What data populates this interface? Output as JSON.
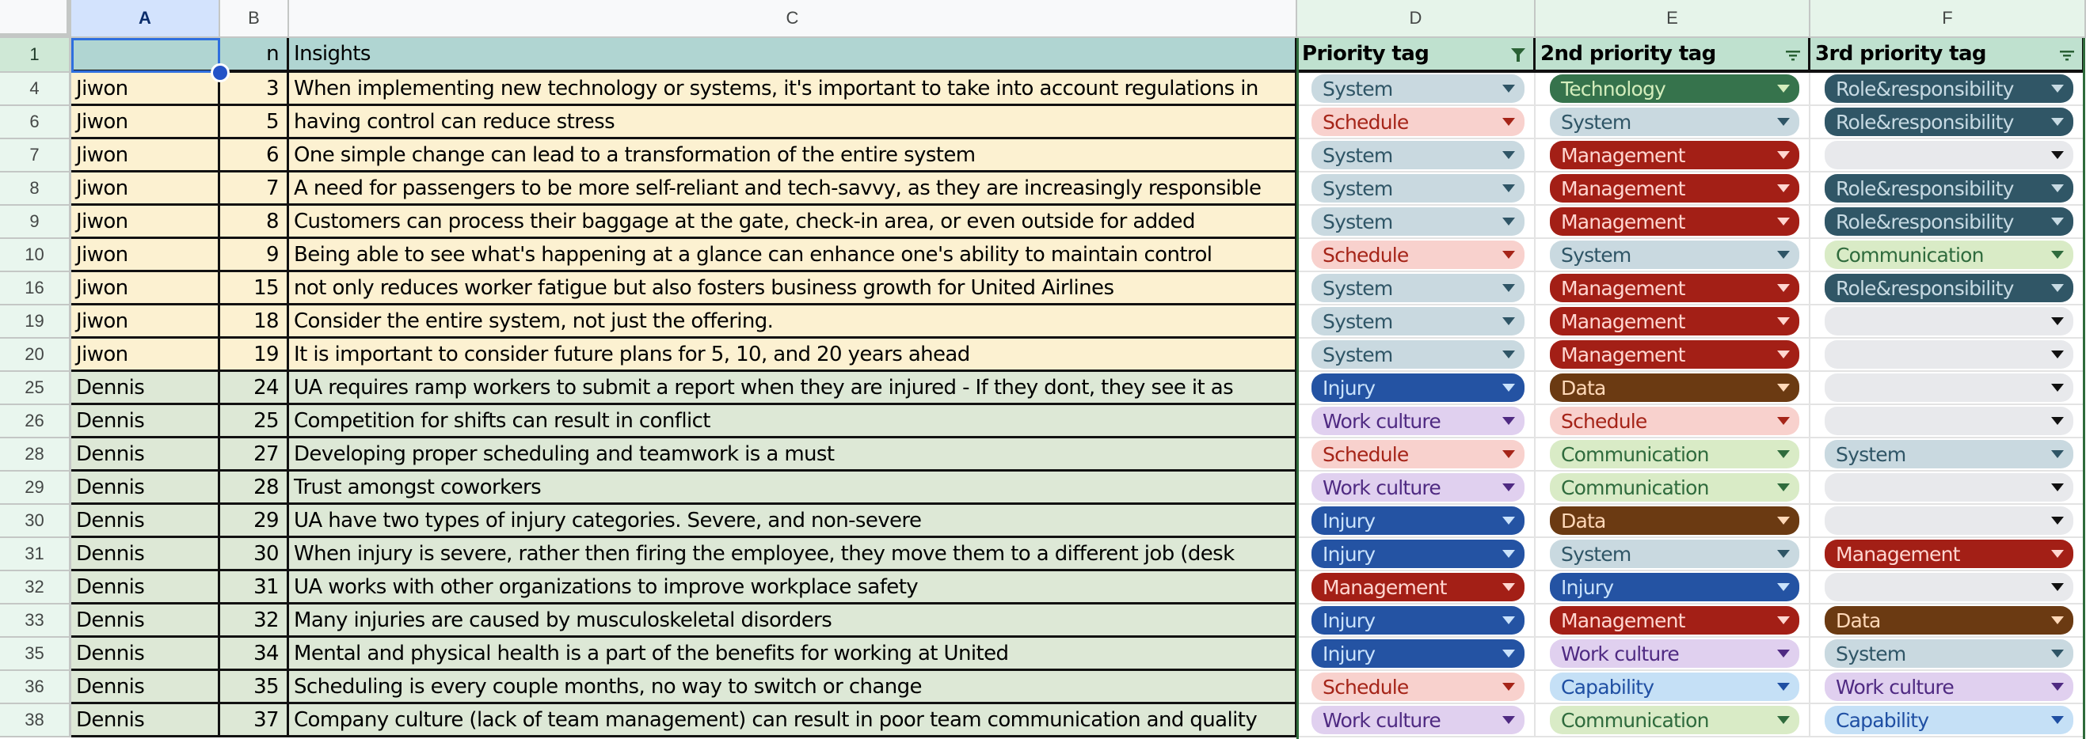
{
  "columns": [
    {
      "letter": "A",
      "selected": true
    },
    {
      "letter": "B"
    },
    {
      "letter": "C"
    },
    {
      "letter": "D"
    },
    {
      "letter": "E"
    },
    {
      "letter": "F"
    }
  ],
  "header_row": {
    "row_number": "1",
    "a": "",
    "b": "n",
    "c": "Insights",
    "d": "Priority tag",
    "e": "2nd priority tag",
    "f": "3rd priority tag",
    "d_filter": "filter-active-icon",
    "e_filter": "filter-icon",
    "f_filter": "filter-icon"
  },
  "tag_styles": {
    "System": {
      "bg": "#c9d9e0",
      "fg": "#2f5566"
    },
    "Schedule": {
      "bg": "#f8d1cd",
      "fg": "#a52418"
    },
    "Technology": {
      "bg": "#36734c",
      "fg": "#d4edbc"
    },
    "Management": {
      "bg": "#a31f16",
      "fg": "#ffd6d0"
    },
    "Role&responsibility": {
      "bg": "#305666",
      "fg": "#c7dae3"
    },
    "Communication": {
      "bg": "#d9ebc6",
      "fg": "#2f6b3d"
    },
    "Injury": {
      "bg": "#2453a3",
      "fg": "#c9e2fb"
    },
    "Data": {
      "bg": "#6b3a12",
      "fg": "#ffd8b8"
    },
    "Work culture": {
      "bg": "#e0d0ef",
      "fg": "#4f2a82"
    },
    "Capability": {
      "bg": "#c5e0f6",
      "fg": "#1f4fa3"
    },
    "": {
      "bg": "#e8e9ec",
      "fg": "#111111"
    }
  },
  "rows": [
    {
      "row": "4",
      "a": "Jiwon",
      "b": "3",
      "c": "When implementing new technology or systems, it's important to take into account regulations in",
      "d": "System",
      "e": "Technology",
      "f": "Role&responsibility"
    },
    {
      "row": "6",
      "a": "Jiwon",
      "b": "5",
      "c": "having control can reduce stress",
      "d": "Schedule",
      "e": "System",
      "f": "Role&responsibility"
    },
    {
      "row": "7",
      "a": "Jiwon",
      "b": "6",
      "c": "One simple change can lead to a transformation of the entire system",
      "d": "System",
      "e": "Management",
      "f": ""
    },
    {
      "row": "8",
      "a": "Jiwon",
      "b": "7",
      "c": "A need for passengers to be more self-reliant and tech-savvy, as they are increasingly responsible",
      "d": "System",
      "e": "Management",
      "f": "Role&responsibility"
    },
    {
      "row": "9",
      "a": "Jiwon",
      "b": "8",
      "c": "Customers can process their baggage at the gate, check-in area, or even outside for added",
      "d": "System",
      "e": "Management",
      "f": "Role&responsibility"
    },
    {
      "row": "10",
      "a": "Jiwon",
      "b": "9",
      "c": "Being able to see what's happening at a glance can enhance one's ability to maintain control",
      "d": "Schedule",
      "e": "System",
      "f": "Communication"
    },
    {
      "row": "16",
      "a": "Jiwon",
      "b": "15",
      "c": "not only reduces worker fatigue but also fosters business growth for United Airlines",
      "d": "System",
      "e": "Management",
      "f": "Role&responsibility"
    },
    {
      "row": "19",
      "a": "Jiwon",
      "b": "18",
      "c": "Consider the entire system, not just the offering.",
      "d": "System",
      "e": "Management",
      "f": ""
    },
    {
      "row": "20",
      "a": "Jiwon",
      "b": "19",
      "c": "It is important to consider future plans for 5, 10, and 20 years ahead",
      "d": "System",
      "e": "Management",
      "f": ""
    },
    {
      "row": "25",
      "a": "Dennis",
      "b": "24",
      "c": "UA requires ramp workers to submit a report when they are injured - If they dont, they see it as",
      "d": "Injury",
      "e": "Data",
      "f": ""
    },
    {
      "row": "26",
      "a": "Dennis",
      "b": "25",
      "c": "Competition for shifts can result in conflict",
      "d": "Work culture",
      "e": "Schedule",
      "f": ""
    },
    {
      "row": "28",
      "a": "Dennis",
      "b": "27",
      "c": "Developing proper scheduling and teamwork is a must",
      "d": "Schedule",
      "e": "Communication",
      "f": "System"
    },
    {
      "row": "29",
      "a": "Dennis",
      "b": "28",
      "c": "Trust amongst coworkers",
      "d": "Work culture",
      "e": "Communication",
      "f": ""
    },
    {
      "row": "30",
      "a": "Dennis",
      "b": "29",
      "c": "UA have two types of injury categories. Severe, and non-severe",
      "d": "Injury",
      "e": "Data",
      "f": ""
    },
    {
      "row": "31",
      "a": "Dennis",
      "b": "30",
      "c": "When injury is severe, rather then firing the employee, they move them to a different job (desk",
      "d": "Injury",
      "e": "System",
      "f": "Management"
    },
    {
      "row": "32",
      "a": "Dennis",
      "b": "31",
      "c": "UA works with other organizations to improve workplace safety",
      "d": "Management",
      "e": "Injury",
      "f": ""
    },
    {
      "row": "33",
      "a": "Dennis",
      "b": "32",
      "c": "Many injuries are caused by musculoskeletal disorders",
      "d": "Injury",
      "e": "Management",
      "f": "Data"
    },
    {
      "row": "35",
      "a": "Dennis",
      "b": "34",
      "c": "Mental and physical health is a part of the benefits for working at United",
      "d": "Injury",
      "e": "Work culture",
      "f": "System"
    },
    {
      "row": "36",
      "a": "Dennis",
      "b": "35",
      "c": "Scheduling is every couple months, no way to switch or change",
      "d": "Schedule",
      "e": "Capability",
      "f": "Work culture"
    },
    {
      "row": "38",
      "a": "Dennis",
      "b": "37",
      "c": "Company culture (lack of team management) can result in poor team communication and quality",
      "d": "Work culture",
      "e": "Communication",
      "f": "Capability"
    }
  ],
  "row_fill_colors": {
    "Jiwon": "#fcf1d1",
    "Dennis": "#dde8d6"
  }
}
